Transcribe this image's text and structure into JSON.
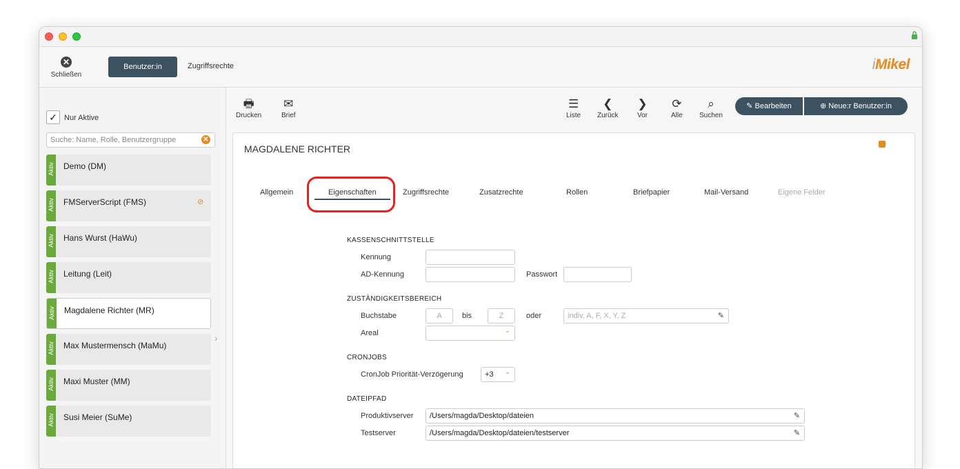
{
  "topbar": {
    "close_label": "Schließen",
    "tab_user": "Benutzer:in",
    "tab_access": "Zugriffsrechte",
    "logo": "iMikel"
  },
  "sidebar": {
    "only_active_label": "Nur Aktive",
    "only_active_checked": true,
    "search_placeholder": "Suche: Name, Rolle, Benutzergruppe",
    "status_label": "Aktiv",
    "items": [
      {
        "name": "Demo (DM)"
      },
      {
        "name": "FMServerScript (FMS)"
      },
      {
        "name": "Hans Wurst (HaWu)"
      },
      {
        "name": "Leitung (Leit)"
      },
      {
        "name": "Magdalene Richter (MR)"
      },
      {
        "name": "Max Mustermensch (MaMu)"
      },
      {
        "name": "Maxi Muster (MM)"
      },
      {
        "name": "Susi Meier (SuMe)"
      }
    ]
  },
  "toolbar": {
    "print": "Drucken",
    "letter": "Brief",
    "list": "Liste",
    "back": "Zurück",
    "forward": "Vor",
    "all": "Alle",
    "search": "Suchen",
    "edit": "Bearbeiten",
    "new_user": "Neue:r Benutzer:in"
  },
  "record": {
    "title": "MAGDALENE RICHTER",
    "tabs": [
      "Allgemein",
      "Eigenschaften",
      "Zugriffsrechte",
      "Zusatzrechte",
      "Rollen",
      "Briefpapier",
      "Mail-Versand",
      "Eigene Felder"
    ],
    "active_tab": "Eigenschaften"
  },
  "form": {
    "kassen": {
      "heading": "KASSENSCHNITTSTELLE",
      "kennung_label": "Kennung",
      "ad_label": "AD-Kennung",
      "passwort_label": "Passwort"
    },
    "zust": {
      "heading": "ZUSTÄNDIGKEITSBEREICH",
      "buchstabe_label": "Buchstabe",
      "from_placeholder": "A",
      "bis_label": "bis",
      "to_placeholder": "Z",
      "oder_label": "oder",
      "indiv_placeholder": "indiv. A, F, X, Y, Z",
      "areal_label": "Areal"
    },
    "cron": {
      "heading": "CRONJOBS",
      "label": "CronJob Priorität-Verzögerung",
      "value": "+3"
    },
    "datei": {
      "heading": "DATEIPFAD",
      "prod_label": "Produktivserver",
      "prod_value": "/Users/magda/Desktop/dateien",
      "test_label": "Testserver",
      "test_value": "/Users/magda/Desktop/dateien/testserver"
    }
  },
  "colors": {
    "accent": "#e58a1f",
    "dark": "#3d5261",
    "active_green": "#6aaa3a",
    "highlight": "#e8201e"
  }
}
